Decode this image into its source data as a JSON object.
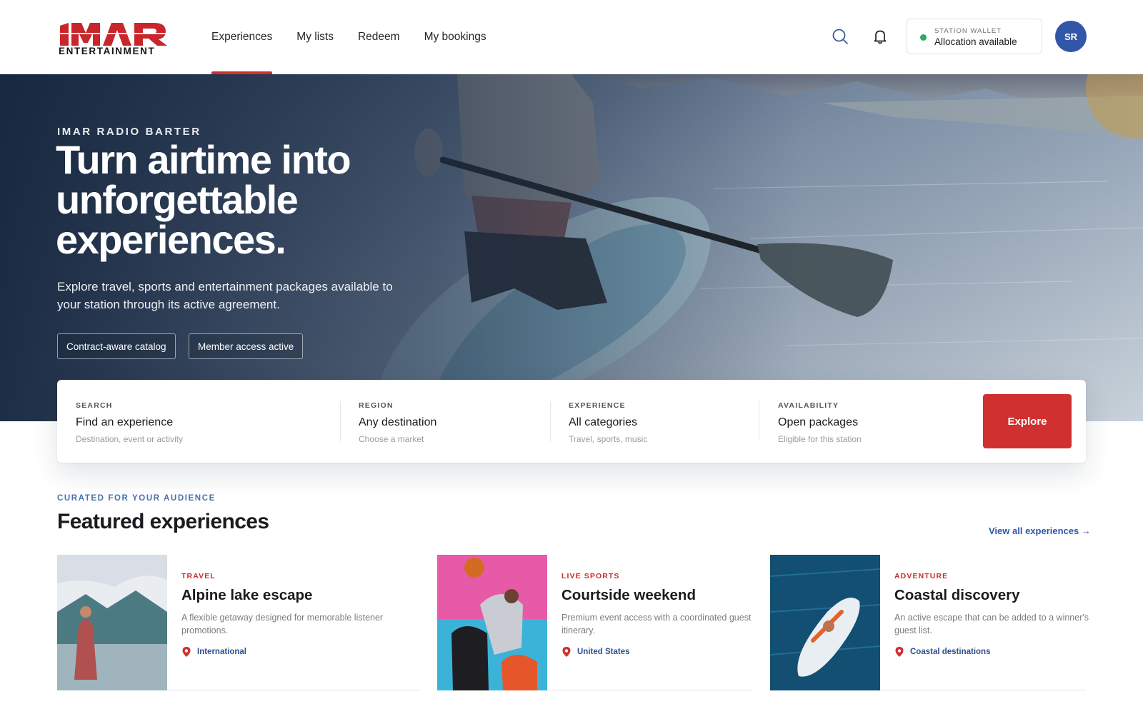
{
  "brand": {
    "logo_word": "IMAR",
    "logo_sub": "ENTERTAINMENT"
  },
  "nav": {
    "items": [
      {
        "label": "Experiences",
        "active": true
      },
      {
        "label": "My lists",
        "active": false
      },
      {
        "label": "Redeem",
        "active": false
      },
      {
        "label": "My bookings",
        "active": false
      }
    ]
  },
  "header": {
    "icons": [
      "search-icon",
      "bell-icon"
    ],
    "wallet": {
      "label": "STATION WALLET",
      "value": "Allocation available",
      "status_color": "#2fa860"
    },
    "avatar_initials": "SR"
  },
  "hero": {
    "eyebrow": "IMAR RADIO BARTER",
    "title": "Turn airtime into unforgettable experiences.",
    "subtitle": "Explore travel, sports and entertainment packages available to your station through its active agreement.",
    "chips": [
      "Contract-aware catalog",
      "Member access active"
    ]
  },
  "search": {
    "fields": [
      {
        "label": "SEARCH",
        "value": "Find an experience",
        "hint": "Destination, event or activity"
      },
      {
        "label": "REGION",
        "value": "Any destination",
        "hint": "Choose a market"
      },
      {
        "label": "EXPERIENCE",
        "value": "All categories",
        "hint": "Travel, sports, music"
      },
      {
        "label": "AVAILABILITY",
        "value": "Open packages",
        "hint": "Eligible for this station"
      }
    ],
    "button_label": "Explore"
  },
  "featured": {
    "eyebrow": "CURATED FOR YOUR AUDIENCE",
    "title": "Featured experiences",
    "view_all": "View all experiences →",
    "cards": [
      {
        "category": "TRAVEL",
        "title": "Alpine lake escape",
        "description": "A flexible getaway designed for memorable listener promotions.",
        "location": "International"
      },
      {
        "category": "LIVE SPORTS",
        "title": "Courtside weekend",
        "description": "Premium event access with a coordinated guest itinerary.",
        "location": "United States"
      },
      {
        "category": "ADVENTURE",
        "title": "Coastal discovery",
        "description": "An active escape that can be added to a winner's guest list.",
        "location": "Coastal destinations"
      }
    ]
  },
  "colors": {
    "accent_red": "#d0302f",
    "link_blue": "#2c58a8",
    "avatar_blue": "#3257a8",
    "category_red": "#c92d2d"
  }
}
